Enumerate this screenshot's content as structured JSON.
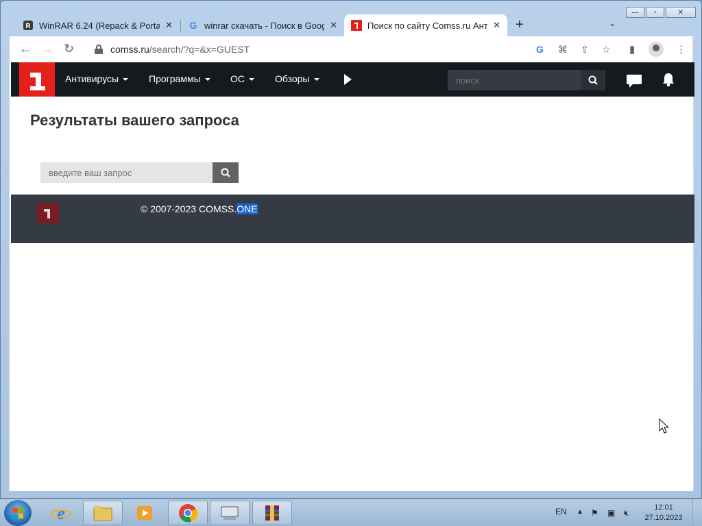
{
  "browser": {
    "tabs": [
      {
        "title": "WinRAR 6.24 (Repack & Portable",
        "favicon": "winrar-favicon",
        "active": false
      },
      {
        "title": "winrar скачать - Поиск в Google",
        "favicon": "google-favicon",
        "active": false
      },
      {
        "title": "Поиск по сайту Comss.ru Антив",
        "favicon": "comss-favicon",
        "active": true
      }
    ],
    "new_tab_symbol": "+",
    "tab_menu_symbol": "⌄",
    "url_domain": "comss.ru",
    "url_path": "/search/?q=&x=GUEST"
  },
  "site": {
    "nav": {
      "items": [
        "Антивирусы",
        "Программы",
        "ОС",
        "Обзоры"
      ],
      "search_placeholder": "поиск"
    },
    "page_title": "Результаты вашего запроса",
    "search": {
      "placeholder": "введите ваш запрос"
    },
    "footer": {
      "copyright_main": "© 2007-2023 COMSS.",
      "copyright_selected": "ONE"
    }
  },
  "taskbar": {
    "language": "EN",
    "time": "12:01",
    "date": "27.10.2023"
  },
  "colors": {
    "brand_red": "#e32019",
    "nav_bg": "#151a1f",
    "footer_bg": "#343b45",
    "selection": "#1a64d0"
  }
}
